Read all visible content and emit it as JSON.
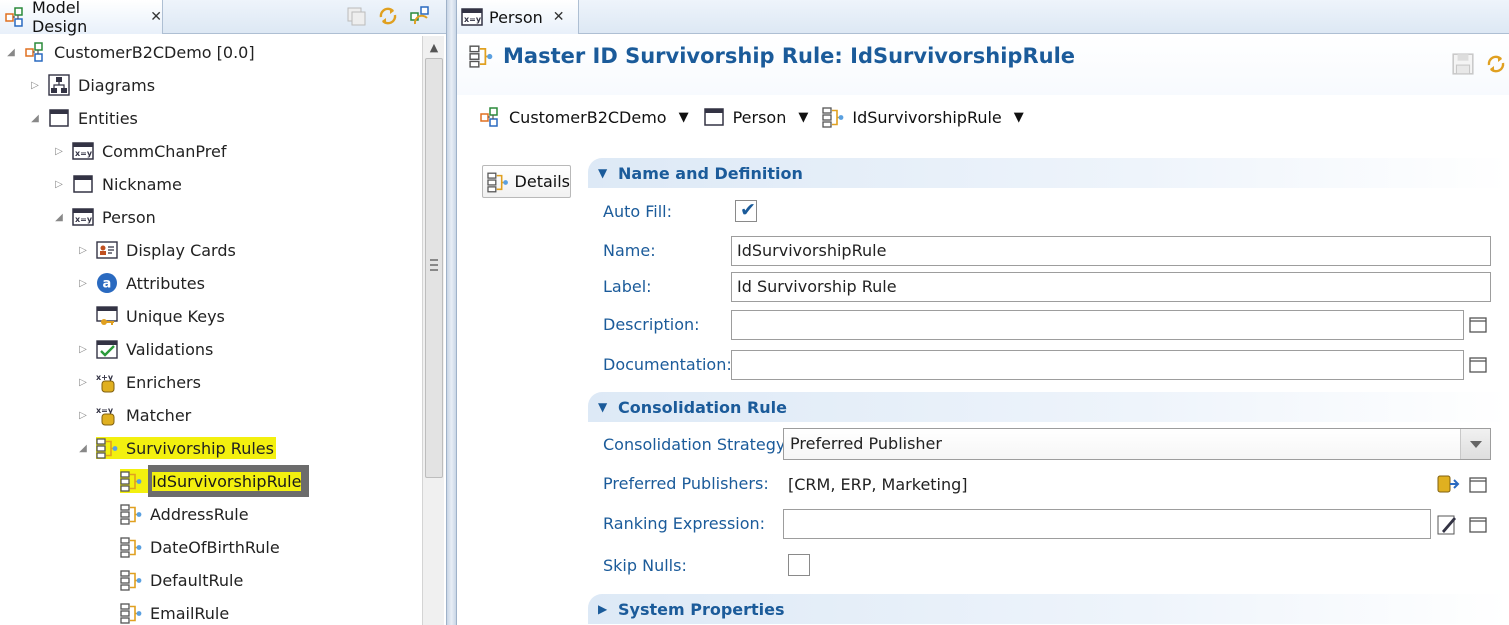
{
  "left_tab": {
    "label": "Model Design",
    "close": "✕"
  },
  "tree": [
    {
      "id": "root",
      "label": "CustomerB2CDemo [0.0]",
      "icon": "model-icon",
      "twisty": "◢"
    },
    {
      "id": "diagrams",
      "label": "Diagrams",
      "icon": "diagram-icon",
      "twisty": "▷"
    },
    {
      "id": "entities",
      "label": "Entities",
      "icon": "window-icon",
      "twisty": "◢"
    },
    {
      "id": "commchanpref",
      "label": "CommChanPref",
      "icon": "entity-xy-icon",
      "twisty": "▷"
    },
    {
      "id": "nickname",
      "label": "Nickname",
      "icon": "window-icon",
      "twisty": "▷"
    },
    {
      "id": "person",
      "label": "Person",
      "icon": "entity-xy-icon",
      "twisty": "◢"
    },
    {
      "id": "display-cards",
      "label": "Display Cards",
      "icon": "card-icon",
      "twisty": "▷"
    },
    {
      "id": "attributes",
      "label": "Attributes",
      "icon": "attribute-icon",
      "twisty": "▷"
    },
    {
      "id": "unique-keys",
      "label": "Unique Keys",
      "icon": "key-icon",
      "twisty": ""
    },
    {
      "id": "validations",
      "label": "Validations",
      "icon": "validation-icon",
      "twisty": "▷"
    },
    {
      "id": "enrichers",
      "label": "Enrichers",
      "icon": "enricher-icon",
      "twisty": "▷"
    },
    {
      "id": "matcher",
      "label": "Matcher",
      "icon": "matcher-icon",
      "twisty": "▷"
    },
    {
      "id": "survivorship-rules",
      "label": "Survivorship Rules",
      "icon": "rule-icon",
      "twisty": "◢"
    },
    {
      "id": "idsurvivorshiprule",
      "label": "IdSurvivorshipRule",
      "icon": "rule-icon",
      "twisty": ""
    },
    {
      "id": "addressrule",
      "label": "AddressRule",
      "icon": "rule-icon",
      "twisty": ""
    },
    {
      "id": "dateofbirthrule",
      "label": "DateOfBirthRule",
      "icon": "rule-icon",
      "twisty": ""
    },
    {
      "id": "defaultrule",
      "label": "DefaultRule",
      "icon": "rule-icon",
      "twisty": ""
    },
    {
      "id": "emailrule",
      "label": "EmailRule",
      "icon": "rule-icon",
      "twisty": ""
    }
  ],
  "right_tab": {
    "label": "Person",
    "close": "✕"
  },
  "form": {
    "title": "Master ID Survivorship Rule: IdSurvivorshipRule",
    "breadcrumbs": [
      {
        "label": "CustomerB2CDemo",
        "icon": "model-icon",
        "caret": "▼"
      },
      {
        "label": "Person",
        "icon": "window-icon",
        "caret": "▼"
      },
      {
        "label": "IdSurvivorshipRule",
        "icon": "rule-icon",
        "caret": "▼"
      }
    ],
    "details_button": "Details",
    "sections": {
      "name_def": {
        "title": "Name and Definition",
        "twisty": "▼"
      },
      "consolidation": {
        "title": "Consolidation Rule",
        "twisty": "▼"
      },
      "system": {
        "title": "System Properties",
        "twisty": "▶"
      }
    },
    "fields": {
      "auto_fill": {
        "label": "Auto Fill:",
        "checked": true,
        "mark": "✔"
      },
      "name": {
        "label": "Name:",
        "value": "IdSurvivorshipRule"
      },
      "label": {
        "label": "Label:",
        "value": "Id Survivorship Rule"
      },
      "description": {
        "label": "Description:",
        "value": ""
      },
      "documentation": {
        "label": "Documentation:",
        "value": ""
      },
      "consolidation_strategy": {
        "label": "Consolidation Strategy:",
        "value": "Preferred Publisher"
      },
      "preferred_publishers": {
        "label": "Preferred Publishers:",
        "value": "[CRM, ERP, Marketing]"
      },
      "ranking_expression": {
        "label": "Ranking Expression:",
        "value": ""
      },
      "skip_nulls": {
        "label": "Skip Nulls:",
        "checked": false
      }
    }
  },
  "colors": {
    "accent": "#1b5b9a",
    "highlight": "#f3f00f",
    "selected_bg": "#6c6c6c"
  }
}
